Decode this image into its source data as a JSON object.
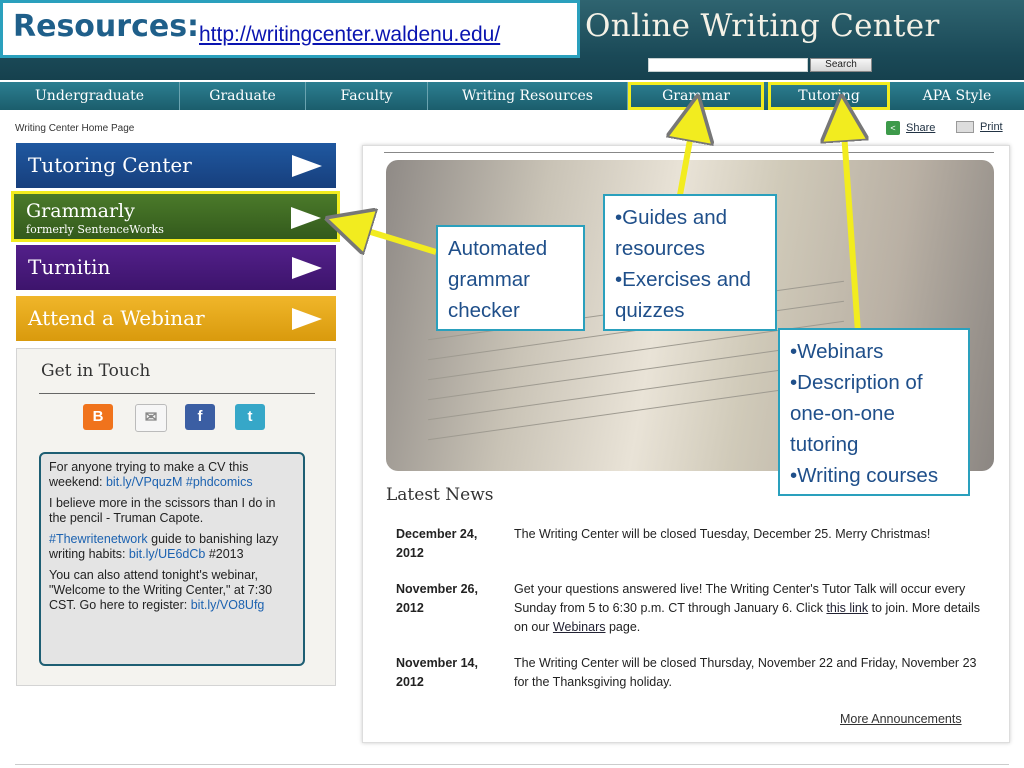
{
  "header": {
    "site_title": "Online Writing Center",
    "search_button": "Search"
  },
  "resources": {
    "title": "Resources:",
    "link": "http://writingcenter.waldenu.edu/"
  },
  "nav": [
    "Undergraduate",
    "Graduate",
    "Faculty",
    "Writing Resources",
    "Grammar",
    "Tutoring",
    "APA Style"
  ],
  "breadcrumb": "Writing Center Home Page",
  "utility": {
    "share": "Share",
    "print": "Print"
  },
  "side_buttons": {
    "tutoring": "Tutoring Center",
    "grammarly": "Grammarly",
    "grammarly_sub": "formerly SentenceWorks",
    "turnitin": "Turnitin",
    "webinar": "Attend a Webinar"
  },
  "touch": {
    "title": "Get in Touch",
    "icons": [
      "blogger-icon",
      "mail-icon",
      "facebook-icon",
      "twitter-icon"
    ],
    "tweets": [
      {
        "text": "For anyone trying to make a CV this weekend: ",
        "link": "bit.ly/VPquzM #phdcomics"
      },
      {
        "text": "I believe more in the scissors than I do in the pencil - Truman Capote.",
        "link": ""
      },
      {
        "prefix": "#Thewritenetwork",
        "text": " guide to banishing lazy writing habits: ",
        "link": "bit.ly/UE6dCb",
        "suffix": " #2013"
      },
      {
        "text": "You can also attend tonight's webinar, \"Welcome to the Writing Center,\" at 7:30 CST. Go here to register: ",
        "link": "bit.ly/VO8Ufg"
      }
    ]
  },
  "news": {
    "heading": "Latest News",
    "items": [
      {
        "date": "December 24, 2012",
        "text": "The Writing Center will be closed Tuesday, December 25. Merry Christmas!"
      },
      {
        "date": "November 26, 2012",
        "text_a": "Get your questions answered live! The Writing Center's Tutor Talk will occur every Sunday from 5 to 6:30 p.m. CT through January 6. Click ",
        "link1": "this link",
        "text_b": " to join. More details on our ",
        "link2": "Webinars",
        "text_c": " page."
      },
      {
        "date": "November 14, 2012",
        "text": "The Writing Center will be closed Thursday, November 22 and Friday, November 23 for the Thanksgiving holiday."
      }
    ],
    "more": "More Announcements"
  },
  "callouts": {
    "grammarly": "Automated grammar checker",
    "grammar": [
      "•Guides and resources",
      "•Exercises and quizzes"
    ],
    "tutoring": [
      "•Webinars",
      "•Description of one-on-one tutoring",
      "•Writing courses"
    ]
  },
  "colors": {
    "highlight": "#f2ec1f",
    "callout_border": "#2aa0bd",
    "header": "#1a4957"
  }
}
